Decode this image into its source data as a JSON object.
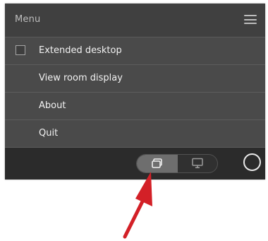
{
  "header": {
    "title": "Menu",
    "menu_icon": "hamburger-icon"
  },
  "menu": {
    "items": [
      {
        "label": "Extended desktop",
        "has_checkbox": true,
        "checked": false
      },
      {
        "label": "View room display",
        "has_checkbox": false
      },
      {
        "label": "About",
        "has_checkbox": false
      },
      {
        "label": "Quit",
        "has_checkbox": false
      }
    ]
  },
  "footer": {
    "toggle": {
      "left_icon": "share-screen-icon",
      "right_icon": "monitor-icon",
      "selected": "left"
    },
    "circle_button_icon": "circle-icon"
  },
  "annotation": {
    "arrow_color": "#d32027",
    "arrow_icon": "pointer-arrow"
  },
  "colors": {
    "panel_bg": "#4a4a4a",
    "footer_bg": "#2b2b2b",
    "toggle_selected": "#6e6e6e",
    "arrow": "#d32027"
  }
}
